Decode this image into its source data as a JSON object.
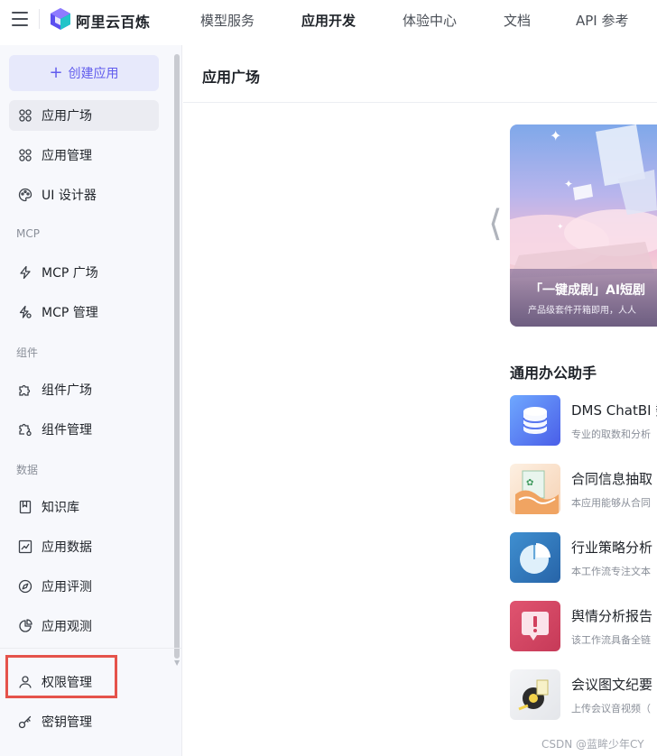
{
  "topbar": {
    "logo_text": "阿里云百炼",
    "nav": [
      "模型服务",
      "应用开发",
      "体验中心",
      "文档",
      "API 参考"
    ],
    "active_nav": "应用开发"
  },
  "sidebar": {
    "create_button": "创建应用",
    "items": [
      {
        "label": "应用广场",
        "icon": "grid-icon"
      },
      {
        "label": "应用管理",
        "icon": "grid-icon"
      },
      {
        "label": "UI 设计器",
        "icon": "palette-icon"
      },
      {
        "label": "MCP 广场",
        "icon": "lightning-icon"
      },
      {
        "label": "MCP 管理",
        "icon": "lightning-settings-icon"
      },
      {
        "label": "组件广场",
        "icon": "puzzle-icon"
      },
      {
        "label": "组件管理",
        "icon": "puzzle-settings-icon"
      },
      {
        "label": "知识库",
        "icon": "book-icon"
      },
      {
        "label": "应用数据",
        "icon": "chart-icon"
      },
      {
        "label": "应用评测",
        "icon": "compass-icon"
      },
      {
        "label": "应用观测",
        "icon": "pie-icon"
      },
      {
        "label": "权限管理",
        "icon": "user-icon"
      },
      {
        "label": "密钥管理",
        "icon": "key-icon"
      }
    ],
    "groups": [
      "MCP",
      "组件",
      "数据"
    ]
  },
  "content": {
    "title": "应用广场",
    "banner": {
      "title": "「一键成剧」AI短剧",
      "subtitle": "产品级套件开箱即用，人人"
    },
    "section_title": "通用办公助手",
    "apps": [
      {
        "name": "DMS ChatBI 数",
        "desc": "专业的取数和分析",
        "icon": "database-icon"
      },
      {
        "name": "合同信息抽取",
        "desc": "本应用能够从合同",
        "icon": "contract-icon"
      },
      {
        "name": "行业策略分析",
        "desc": "本工作流专注文本",
        "icon": "pie-chart-icon"
      },
      {
        "name": "舆情分析报告",
        "desc": "该工作流具备全链",
        "icon": "alert-icon"
      },
      {
        "name": "会议图文纪要",
        "desc": "上传会议音视频（",
        "icon": "tape-icon"
      }
    ]
  },
  "watermark": "CSDN @蓝眸少年CY",
  "colors": {
    "accent": "#615ced",
    "highlight": "#e5534b",
    "sidebar_bg": "#f7f8fc"
  }
}
